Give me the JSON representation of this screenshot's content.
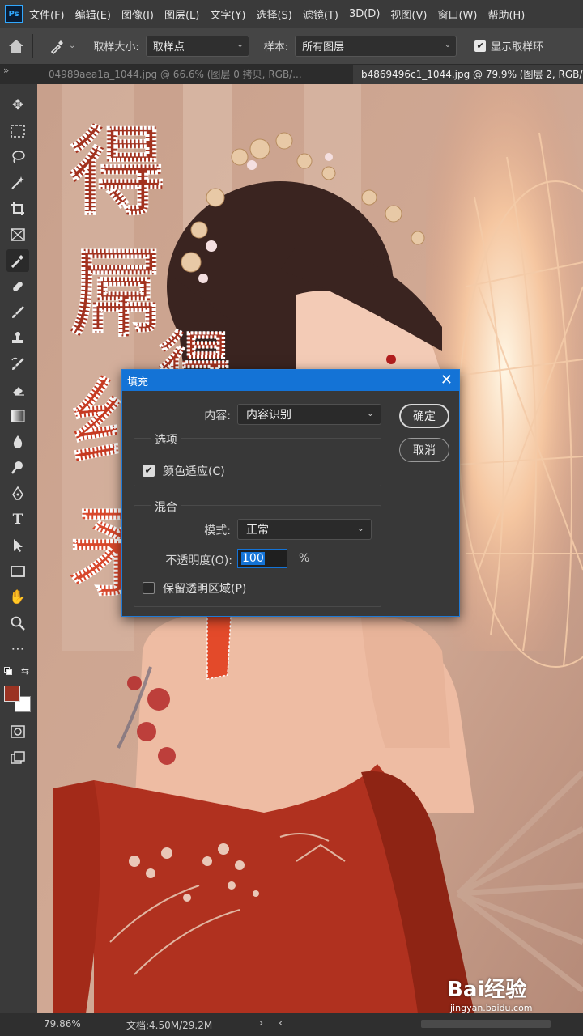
{
  "app": {
    "logo": "Ps"
  },
  "menu": [
    "文件(F)",
    "编辑(E)",
    "图像(I)",
    "图层(L)",
    "文字(Y)",
    "选择(S)",
    "滤镜(T)",
    "3D(D)",
    "视图(V)",
    "窗口(W)",
    "帮助(H)"
  ],
  "options": {
    "sample_size_label": "取样大小:",
    "sample_size_value": "取样点",
    "sample_label": "样本:",
    "sample_value": "所有图层",
    "show_ring_label": "显示取样环"
  },
  "tabs": [
    {
      "label": "04989aea1a_1044.jpg @ 66.6% (图层 0 拷贝, RGB/...",
      "active": false
    },
    {
      "label": "b4869496c1_1044.jpg @ 79.9% (图层 2, RGB/...",
      "active": true
    }
  ],
  "canvas": {
    "text_overlay": [
      "得",
      "屌",
      "得",
      "纟",
      "矛"
    ]
  },
  "dialog": {
    "title": "填充",
    "content_label": "内容:",
    "content_value": "内容识别",
    "options_group": "选项",
    "color_adapt_label": "颜色适应(C)",
    "color_adapt_checked": true,
    "blend_group": "混合",
    "mode_label": "模式:",
    "mode_value": "正常",
    "opacity_label": "不透明度(O):",
    "opacity_value": "100",
    "opacity_unit": "%",
    "preserve_label": "保留透明区域(P)",
    "preserve_checked": false,
    "ok_label": "确定",
    "cancel_label": "取消"
  },
  "status": {
    "zoom": "79.86%",
    "doc_info": "文档:4.50M/29.2M"
  },
  "watermark": {
    "brand": "Bai经验",
    "url": "jingyan.baidu.com"
  },
  "colors": {
    "foreground": "#9b3322",
    "background": "#ffffff",
    "accent": "#1473d6"
  }
}
